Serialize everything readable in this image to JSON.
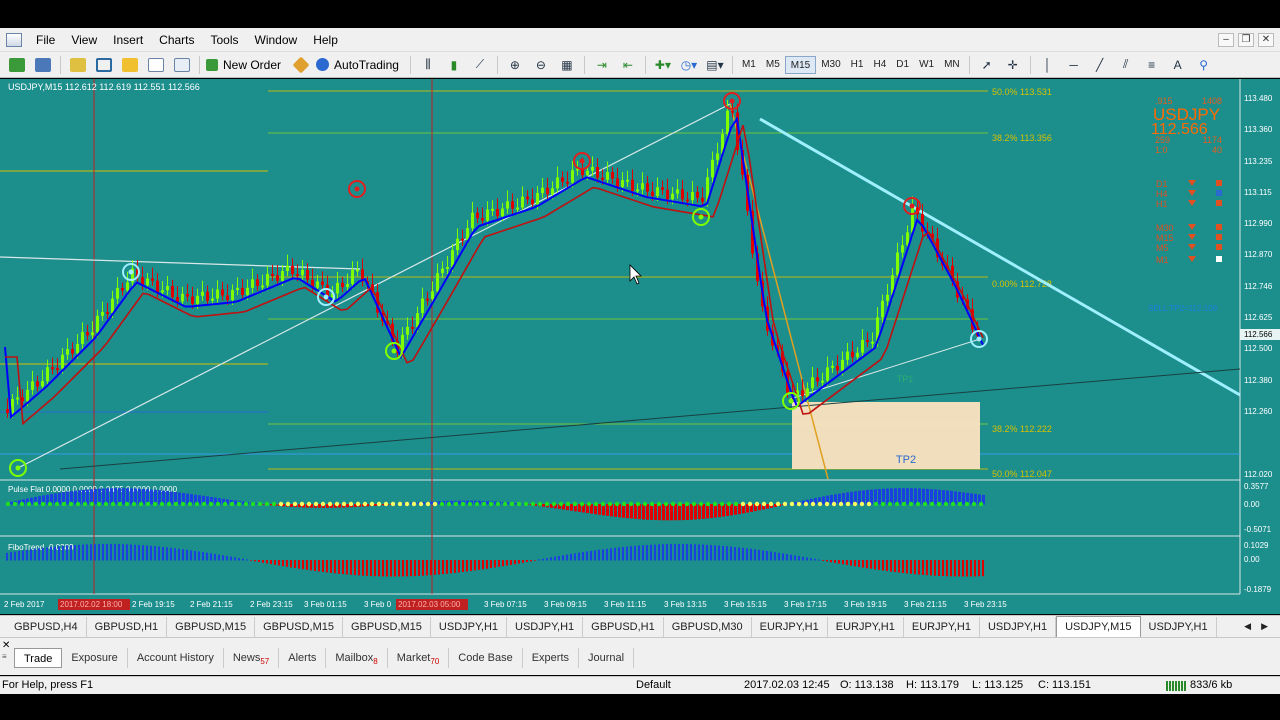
{
  "menu": {
    "items": [
      "File",
      "View",
      "Insert",
      "Charts",
      "Tools",
      "Window",
      "Help"
    ]
  },
  "toolbar": {
    "new_order_label": "New Order",
    "autotrading_label": "AutoTrading",
    "timeframes": [
      "M1",
      "M5",
      "M15",
      "M30",
      "H1",
      "H4",
      "D1",
      "W1",
      "MN"
    ],
    "active_timeframe": "M15"
  },
  "chart": {
    "header": "USDJPY,M15  112.612 112.619 112.551 112.566",
    "symbol_big": "USDJPY",
    "price_big": "112.566",
    "info_small": [
      ".915",
      "1408",
      "259",
      "1174",
      "1:0",
      "40"
    ],
    "tf_indicators": [
      "D1",
      "H4",
      "H1",
      "M30",
      "M15",
      "M5",
      "M1"
    ],
    "price_axis": [
      "113.480",
      "113.360",
      "113.235",
      "113.115",
      "112.990",
      "112.870",
      "112.746",
      "112.625",
      "112.566",
      "112.500",
      "112.380",
      "112.260",
      "112.020"
    ],
    "fib_labels": [
      "50.0%  113.531",
      "38.2%  113.356",
      "0.00%  112.728",
      "38.2%  112.222",
      "50.0%  112.047"
    ],
    "sell_label": "SELL TP2=112.109",
    "tp_label": "TP2",
    "tp1_label": "TP1",
    "time_axis": [
      "2 Feb 2017",
      "2 Feb 19:15",
      "2 Feb 21:15",
      "2 Feb 23:15",
      "3 Feb 01:15",
      "3 Feb 0",
      "3 Feb 07:15",
      "3 Feb 09:15",
      "3 Feb 11:15",
      "3 Feb 13:15",
      "3 Feb 15:15",
      "3 Feb 17:15",
      "3 Feb 19:15",
      "3 Feb 21:15",
      "3 Feb 23:15"
    ],
    "time_highlights": [
      "2017.02.02 18:00",
      "2017.02.03 05:00"
    ],
    "pulse_label": "Pulse Flat 0.0000 0.0000 0.0475 0.0000 0.0000",
    "pulse_axis": [
      "0.3577",
      "0.00",
      "-0.5071"
    ],
    "fibo_label": "FiboTrend -0.0389",
    "fibo_axis": [
      "0.1029",
      "0.00",
      "-0.1879"
    ]
  },
  "chart_tabs": [
    "GBPUSD,H4",
    "GBPUSD,H1",
    "GBPUSD,M15",
    "GBPUSD,M15",
    "GBPUSD,M15",
    "USDJPY,H1",
    "USDJPY,H1",
    "GBPUSD,H1",
    "GBPUSD,M30",
    "EURJPY,H1",
    "EURJPY,H1",
    "EURJPY,H1",
    "USDJPY,H1",
    "USDJPY,M15",
    "USDJPY,H1"
  ],
  "active_chart_tab": "USDJPY,M15",
  "terminal_tabs": [
    {
      "label": "Trade",
      "badge": ""
    },
    {
      "label": "Exposure",
      "badge": ""
    },
    {
      "label": "Account History",
      "badge": ""
    },
    {
      "label": "News",
      "badge": "57"
    },
    {
      "label": "Alerts",
      "badge": ""
    },
    {
      "label": "Mailbox",
      "badge": "8"
    },
    {
      "label": "Market",
      "badge": "70"
    },
    {
      "label": "Code Base",
      "badge": ""
    },
    {
      "label": "Experts",
      "badge": ""
    },
    {
      "label": "Journal",
      "badge": ""
    }
  ],
  "status": {
    "help": "For Help, press F1",
    "profile": "Default",
    "datetime": "2017.02.03 12:45",
    "open": "O: 113.138",
    "high": "H: 113.179",
    "low": "L: 113.125",
    "close": "C: 113.151",
    "traffic": "833/6 kb"
  },
  "colors": {
    "chart_bg": "#1c8e8c",
    "bull": "#7fff00",
    "bear": "#e00000",
    "ma_blue": "#0000ff",
    "ma_red": "#c01010",
    "fib_line": "#d8c000",
    "accent": "#ff6a00"
  }
}
